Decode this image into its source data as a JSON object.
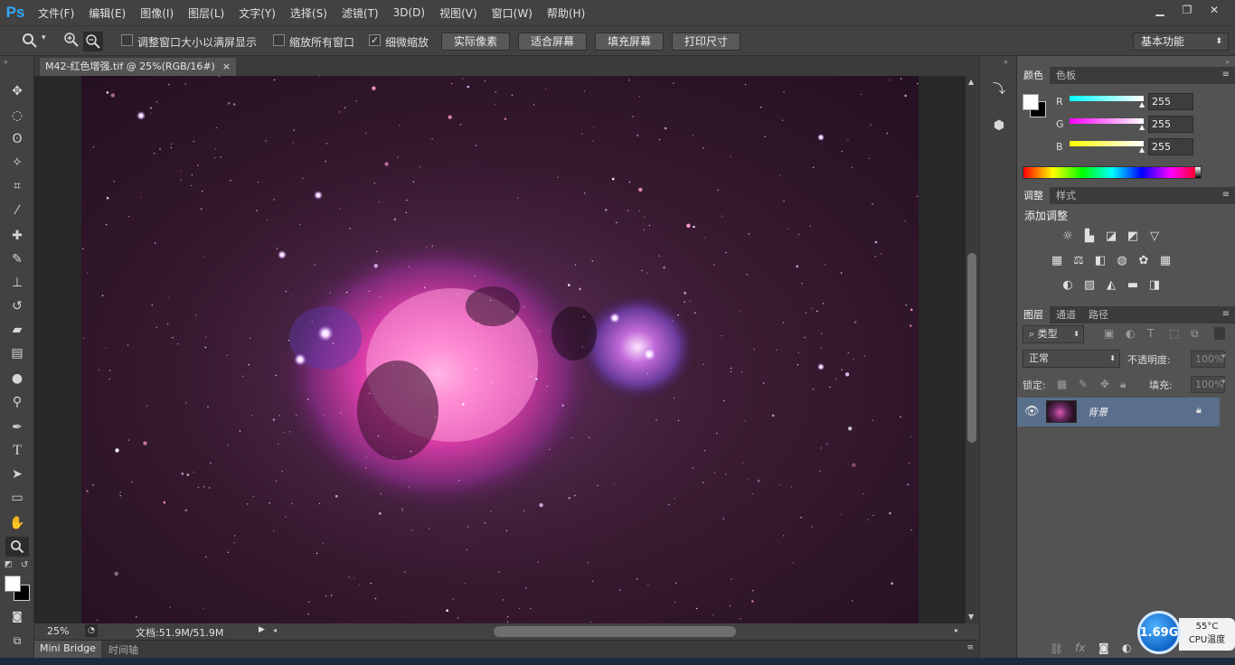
{
  "app": {
    "logo": "Ps"
  },
  "menu": [
    "文件(F)",
    "编辑(E)",
    "图像(I)",
    "图层(L)",
    "文字(Y)",
    "选择(S)",
    "滤镜(T)",
    "3D(D)",
    "视图(V)",
    "窗口(W)",
    "帮助(H)"
  ],
  "options": {
    "resize_windows_label": "调整窗口大小以满屏显示",
    "zoom_all_label": "缩放所有窗口",
    "scrubby_zoom_label": "细微缩放",
    "actual_pixels": "实际像素",
    "fit_screen": "适合屏幕",
    "fill_screen": "填充屏幕",
    "print_size": "打印尺寸",
    "workspace": "基本功能"
  },
  "document": {
    "tab_title": "M42-红色增强.tif @ 25%(RGB/16#)",
    "zoom": "25%",
    "doc_info": "文档:51.9M/51.9M"
  },
  "bottom_tabs": [
    "Mini Bridge",
    "时间轴"
  ],
  "color_panel": {
    "tabs": [
      "颜色",
      "色板"
    ],
    "channels": [
      {
        "label": "R",
        "value": "255"
      },
      {
        "label": "G",
        "value": "255"
      },
      {
        "label": "B",
        "value": "255"
      }
    ]
  },
  "adjust_panel": {
    "tabs": [
      "调整",
      "样式"
    ],
    "title": "添加调整"
  },
  "layers_panel": {
    "tabs": [
      "图层",
      "通道",
      "路径"
    ],
    "filter_kind": "类型",
    "blend_mode": "正常",
    "opacity_label": "不透明度:",
    "opacity_value": "100%",
    "lock_label": "锁定:",
    "fill_label": "填充:",
    "fill_value": "100%",
    "layer_name": "背景"
  },
  "cpu_widget": {
    "speed": "1.69G",
    "temp": "55°C",
    "label": "CPU温度"
  }
}
